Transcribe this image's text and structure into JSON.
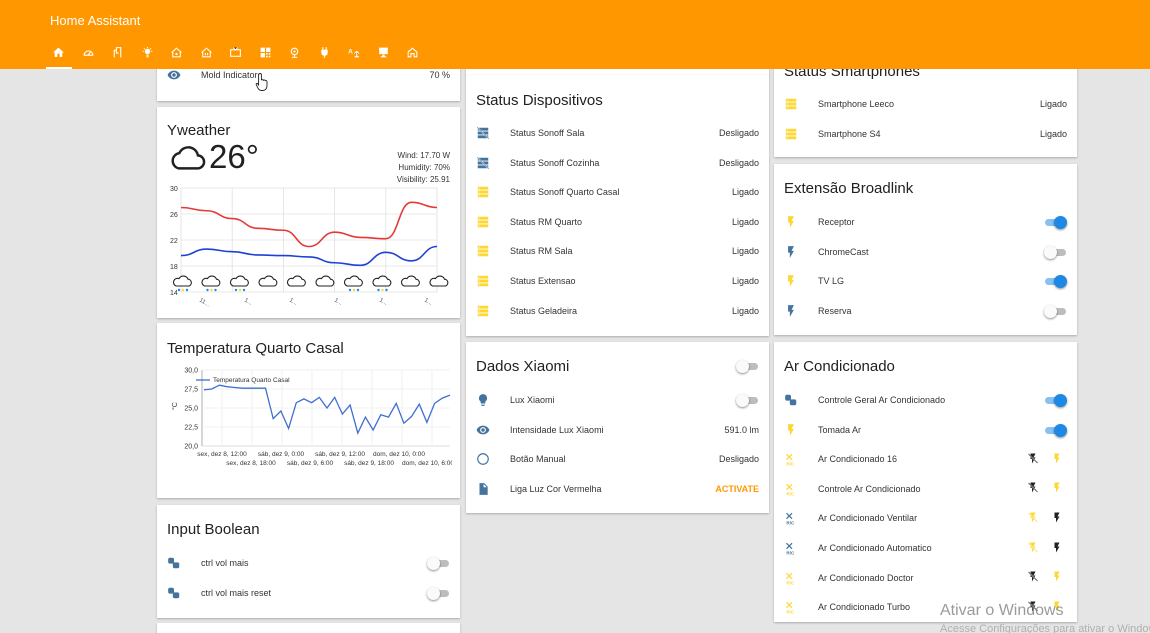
{
  "app": {
    "title": "Home Assistant"
  },
  "tabs": [
    {
      "icon": "home-icon"
    },
    {
      "icon": "gauge-icon"
    },
    {
      "icon": "switch-box-icon"
    },
    {
      "icon": "lightbulb-icon"
    },
    {
      "icon": "house-fan-icon"
    },
    {
      "icon": "house-heat-icon"
    },
    {
      "icon": "tv-icon"
    },
    {
      "icon": "qrcode-icon"
    },
    {
      "icon": "webcam-icon"
    },
    {
      "icon": "power-plug-icon"
    },
    {
      "icon": "text-to-speech-icon"
    },
    {
      "icon": "desktop-icon"
    },
    {
      "icon": "home-outline-icon"
    }
  ],
  "mold": {
    "label": "Mold Indicator",
    "value": "70 %"
  },
  "weather": {
    "title": "Yweather",
    "temperature": "26°",
    "wind": "Wind: 17.70 W",
    "humidity": "Humidity: 70%",
    "visibility": "Visibility: 25.91",
    "x_labels": [
      "11...",
      "1...",
      "1...",
      "1...",
      "1...",
      "1..."
    ],
    "chart_data": {
      "type": "line",
      "ylim": [
        14,
        30
      ],
      "yticks": [
        "30",
        "26",
        "22",
        "18",
        "14"
      ],
      "series": [
        {
          "color": "#e53935",
          "values": [
            27,
            26.5,
            25.3,
            23.8,
            23.5,
            21,
            23.2,
            22.4,
            22.2,
            27.8,
            27
          ]
        },
        {
          "color": "#1e40d6",
          "values": [
            19.6,
            20.6,
            20.2,
            19.7,
            19.6,
            19.4,
            18.5,
            18.1,
            20.1,
            18.8,
            21
          ]
        }
      ]
    }
  },
  "temperatura": {
    "title": "Temperatura Quarto Casal",
    "legend": "Temperatura Quarto Casal",
    "ylabel": "°C",
    "yticks": [
      "30,0",
      "27,5",
      "25,0",
      "22,5",
      "20,0"
    ],
    "xticks_top": [
      "sex, dez 8, 12:00",
      "sáb, dez 9, 0:00",
      "sáb, dez 9, 12:00",
      "dom, dez 10, 0:00"
    ],
    "xticks_bottom": [
      "sex, dez 8, 18:00",
      "sáb, dez 9, 6:00",
      "sáb, dez 9, 18:00",
      "dom, dez 10, 6:00"
    ],
    "chart_data": {
      "type": "line",
      "ylim": [
        20,
        30
      ],
      "values": [
        27.4,
        27.5,
        28.0,
        27.8,
        27.7,
        27.6,
        27.6,
        27.6,
        27.6,
        23.6,
        24.6,
        22.3,
        25.7,
        26.2,
        25.7,
        26.4,
        25.0,
        26.4,
        24.2,
        25.4,
        21.7,
        23.8,
        22.1,
        24.1,
        23.8,
        25.6,
        23.0,
        23.9,
        25.5,
        23.1,
        25.6,
        26.3,
        26.7
      ]
    }
  },
  "input_boolean": {
    "title": "Input Boolean",
    "items": [
      {
        "label": "ctrl vol mais",
        "icon": "toggle-shapes-icon",
        "on": false
      },
      {
        "label": "ctrl vol mais reset",
        "icon": "toggle-shapes-icon",
        "on": false
      }
    ]
  },
  "status_dispositivos": {
    "title": "Status Dispositivos",
    "items": [
      {
        "label": "Status Sonoff Sala",
        "state": "Desligado",
        "icon": "server-off-icon",
        "color": "#44739e"
      },
      {
        "label": "Status Sonoff Cozinha",
        "state": "Desligado",
        "icon": "server-off-icon",
        "color": "#44739e"
      },
      {
        "label": "Status Sonoff Quarto Casal",
        "state": "Ligado",
        "icon": "server-icon",
        "color": "#fdd835"
      },
      {
        "label": "Status RM Quarto",
        "state": "Ligado",
        "icon": "server-icon",
        "color": "#fdd835"
      },
      {
        "label": "Status RM Sala",
        "state": "Ligado",
        "icon": "server-icon",
        "color": "#fdd835"
      },
      {
        "label": "Status Extensao",
        "state": "Ligado",
        "icon": "server-icon",
        "color": "#fdd835"
      },
      {
        "label": "Status Geladeira",
        "state": "Ligado",
        "icon": "server-icon",
        "color": "#fdd835"
      }
    ]
  },
  "dados_xiaomi": {
    "title": "Dados Xiaomi",
    "header_toggle_on": false,
    "items": [
      {
        "label": "Lux Xiaomi",
        "kind": "toggle",
        "on": false,
        "icon": "lightbulb-icon"
      },
      {
        "label": "Intensidade Lux Xiaomi",
        "kind": "state",
        "state": "591.0 lm",
        "icon": "eye-icon"
      },
      {
        "label": "Botão Manual",
        "kind": "state",
        "state": "Desligado",
        "icon": "circle-outline-icon"
      },
      {
        "label": "Liga Luz Cor Vermelha",
        "kind": "action",
        "state": "ACTIVATE",
        "icon": "file-document-icon"
      }
    ]
  },
  "status_smartphones": {
    "title": "Status Smartphones",
    "items": [
      {
        "label": "Smartphone Leeco",
        "state": "Ligado",
        "icon": "server-icon"
      },
      {
        "label": "Smartphone S4",
        "state": "Ligado",
        "icon": "server-icon"
      }
    ]
  },
  "extensao_broadlink": {
    "title": "Extensão Broadlink",
    "items": [
      {
        "label": "Receptor",
        "on": true,
        "color": "#fdd835"
      },
      {
        "label": "ChromeCast",
        "on": false,
        "color": "#44739e"
      },
      {
        "label": "TV LG",
        "on": true,
        "color": "#fdd835"
      },
      {
        "label": "Reserva",
        "on": false,
        "color": "#44739e"
      }
    ]
  },
  "ar_condicionado": {
    "title": "Ar Condicionado",
    "items": [
      {
        "label": "Controle Geral Ar Condicionado",
        "kind": "toggle",
        "on": true,
        "icon": "toggle-shapes-icon",
        "color": "#44739e"
      },
      {
        "label": "Tomada Ar",
        "kind": "toggle",
        "on": true,
        "icon": "flash-icon",
        "color": "#fdd835"
      },
      {
        "label": "Ar Condicionado 16",
        "kind": "ac",
        "color": "#fdd835",
        "off_active": false
      },
      {
        "label": "Controle Ar Condicionado",
        "kind": "ac",
        "color": "#fdd835",
        "off_active": false
      },
      {
        "label": "Ar Condicionado Ventilar",
        "kind": "ac",
        "color": "#44739e",
        "off_active": true
      },
      {
        "label": "Ar Condicionado Automatico",
        "kind": "ac",
        "color": "#44739e",
        "off_active": true
      },
      {
        "label": "Ar Condicionado Doctor",
        "kind": "ac",
        "color": "#fdd835",
        "off_active": false
      },
      {
        "label": "Ar Condicionado Turbo",
        "kind": "ac",
        "color": "#fdd835",
        "off_active": false
      }
    ]
  },
  "watermark": {
    "line1": "Ativar o Windows",
    "line2": "Acesse Configurações para ativar o Windows."
  }
}
